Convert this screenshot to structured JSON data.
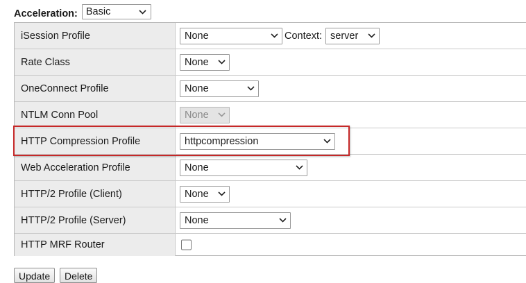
{
  "acceleration": {
    "label": "Acceleration:",
    "value": "Basic"
  },
  "rows": [
    {
      "label": "iSession Profile",
      "value": "None",
      "context_label": "Context:",
      "context_value": "server"
    },
    {
      "label": "Rate Class",
      "value": "None"
    },
    {
      "label": "OneConnect Profile",
      "value": "None"
    },
    {
      "label": "NTLM Conn Pool",
      "value": "None",
      "disabled": true
    },
    {
      "label": "HTTP Compression Profile",
      "value": "httpcompression",
      "highlighted": true
    },
    {
      "label": "Web Acceleration Profile",
      "value": "None"
    },
    {
      "label": "HTTP/2 Profile (Client)",
      "value": "None"
    },
    {
      "label": "HTTP/2 Profile (Server)",
      "value": "None"
    },
    {
      "label": "HTTP MRF Router",
      "checked": false
    }
  ],
  "buttons": {
    "update": "Update",
    "delete": "Delete"
  },
  "colors": {
    "highlight": "#c62828",
    "label_bg": "#ececec"
  },
  "icons": {
    "dropdown": "chevron-down-icon"
  }
}
